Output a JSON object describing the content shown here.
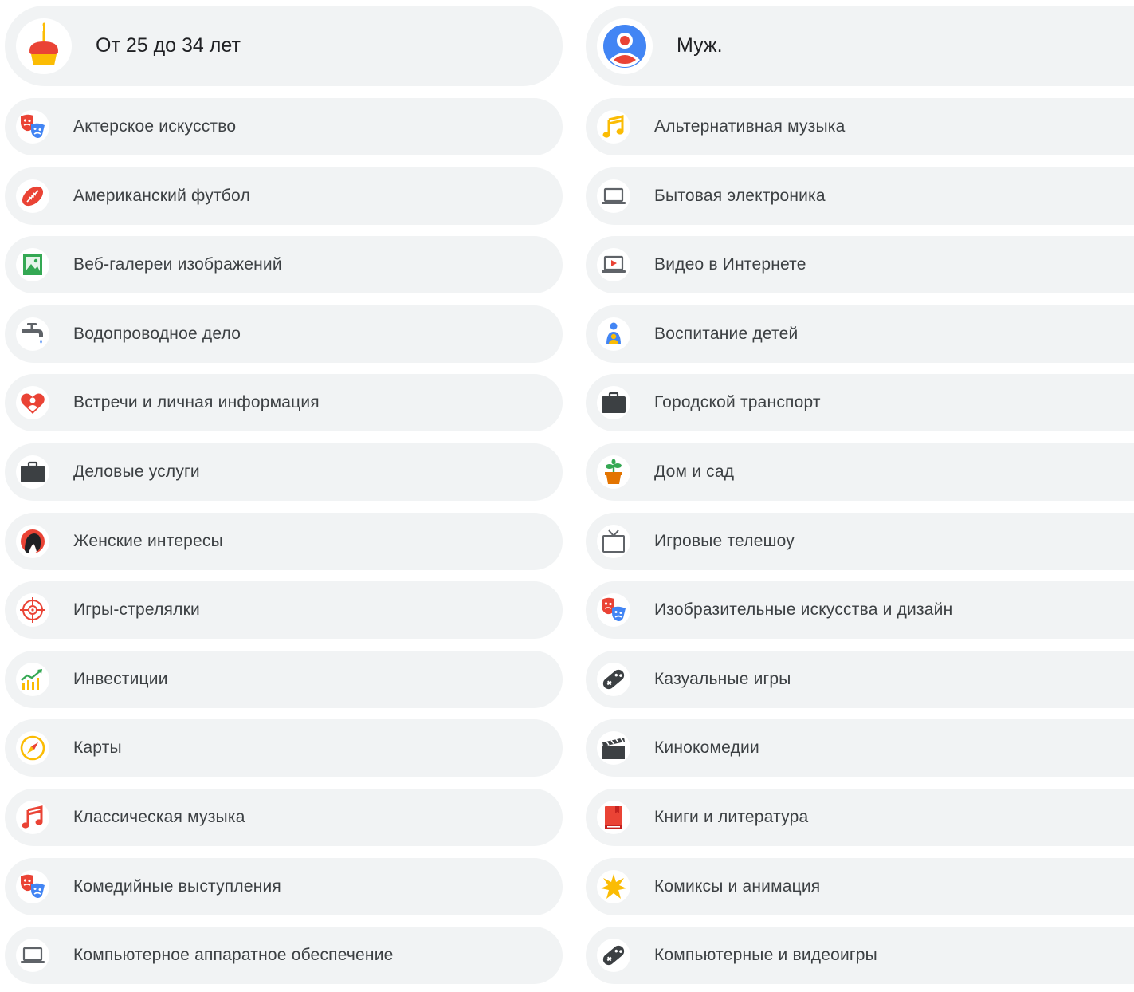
{
  "age": {
    "label": "От 25 до 34 лет",
    "icon": "birthday-cake-icon"
  },
  "gender": {
    "label": "Муж.",
    "icon": "person-avatar-icon"
  },
  "left_items": [
    {
      "label": "Актерское искусство",
      "icon": "theater-masks-icon"
    },
    {
      "label": "Американский футбол",
      "icon": "american-football-icon"
    },
    {
      "label": "Веб-галереи изображений",
      "icon": "image-gallery-icon"
    },
    {
      "label": "Водопроводное дело",
      "icon": "faucet-icon"
    },
    {
      "label": "Встречи и личная информация",
      "icon": "heart-person-icon"
    },
    {
      "label": "Деловые услуги",
      "icon": "briefcase-icon"
    },
    {
      "label": "Женские интересы",
      "icon": "woman-icon"
    },
    {
      "label": "Игры-стрелялки",
      "icon": "crosshair-icon"
    },
    {
      "label": "Инвестиции",
      "icon": "growth-chart-icon"
    },
    {
      "label": "Карты",
      "icon": "compass-icon"
    },
    {
      "label": "Классическая музыка",
      "icon": "music-note-icon"
    },
    {
      "label": "Комедийные выступления",
      "icon": "theater-masks-icon"
    },
    {
      "label": "Компьютерное аппаратное обеспечение",
      "icon": "laptop-icon"
    }
  ],
  "right_items": [
    {
      "label": "Альтернативная музыка",
      "icon": "music-note-icon"
    },
    {
      "label": "Бытовая электроника",
      "icon": "laptop-icon"
    },
    {
      "label": "Видео в Интернете",
      "icon": "video-laptop-icon"
    },
    {
      "label": "Воспитание детей",
      "icon": "parent-child-icon"
    },
    {
      "label": "Городской транспорт",
      "icon": "briefcase-icon"
    },
    {
      "label": "Дом и сад",
      "icon": "potted-plant-icon"
    },
    {
      "label": "Игровые телешоу",
      "icon": "tv-icon"
    },
    {
      "label": "Изобразительные искусства и дизайн",
      "icon": "theater-masks-icon"
    },
    {
      "label": "Казуальные игры",
      "icon": "gamepad-icon"
    },
    {
      "label": "Кинокомедии",
      "icon": "clapperboard-icon"
    },
    {
      "label": "Книги и литература",
      "icon": "book-icon"
    },
    {
      "label": "Комиксы и анимация",
      "icon": "starburst-icon"
    },
    {
      "label": "Компьютерные и видеоигры",
      "icon": "gamepad-icon"
    }
  ]
}
